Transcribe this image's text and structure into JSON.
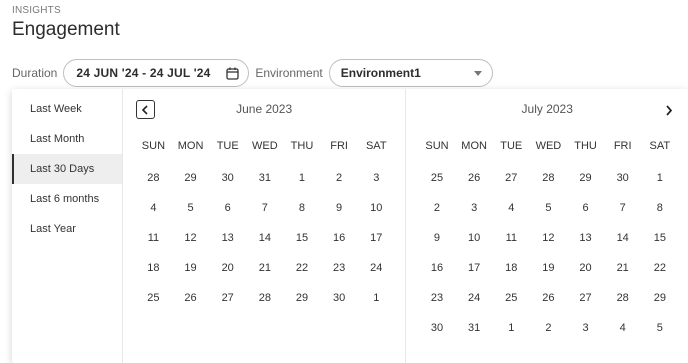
{
  "header": {
    "crumb": "INSIGHTS",
    "title": "Engagement"
  },
  "filters": {
    "duration_label": "Duration",
    "date_range": "24 JUN '24 - 24 JUL '24",
    "environment_label": "Environment",
    "environment_value": "Environment1"
  },
  "presets": [
    "Last Week",
    "Last Month",
    "Last 30 Days",
    "Last 6 months",
    "Last Year"
  ],
  "active_preset": "Last 30 Days",
  "weekdays": [
    "SUN",
    "MON",
    "TUE",
    "WED",
    "THU",
    "FRI",
    "SAT"
  ],
  "months": [
    {
      "title": "June 2023",
      "weeks": [
        [
          "28",
          "29",
          "30",
          "31",
          "1",
          "2",
          "3"
        ],
        [
          "4",
          "5",
          "6",
          "7",
          "8",
          "9",
          "10"
        ],
        [
          "11",
          "12",
          "13",
          "14",
          "15",
          "16",
          "17"
        ],
        [
          "18",
          "19",
          "20",
          "21",
          "22",
          "23",
          "24"
        ],
        [
          "25",
          "26",
          "27",
          "28",
          "29",
          "30",
          "1"
        ]
      ]
    },
    {
      "title": "July 2023",
      "weeks": [
        [
          "25",
          "26",
          "27",
          "28",
          "29",
          "30",
          "1"
        ],
        [
          "2",
          "3",
          "4",
          "5",
          "6",
          "7",
          "8"
        ],
        [
          "9",
          "10",
          "11",
          "12",
          "13",
          "14",
          "15"
        ],
        [
          "16",
          "17",
          "18",
          "19",
          "20",
          "21",
          "22"
        ],
        [
          "23",
          "24",
          "25",
          "26",
          "27",
          "28",
          "29"
        ],
        [
          "30",
          "31",
          "1",
          "2",
          "3",
          "4",
          "5"
        ]
      ]
    }
  ],
  "icons": {
    "calendar": "calendar-icon",
    "dropdown": "chevron-down-icon",
    "prev": "chevron-left-icon",
    "next": "chevron-right-icon"
  }
}
